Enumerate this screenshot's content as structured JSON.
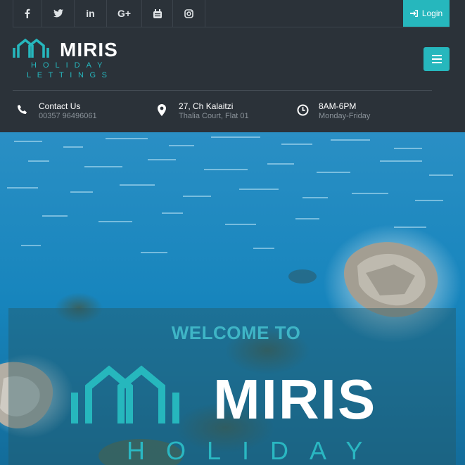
{
  "social": {
    "items": [
      {
        "name": "facebook",
        "icon": "facebook-icon"
      },
      {
        "name": "twitter",
        "icon": "twitter-icon"
      },
      {
        "name": "linkedin",
        "icon": "linkedin-icon",
        "glyph": "in"
      },
      {
        "name": "google-plus",
        "icon": "google-plus-icon",
        "glyph": "G+"
      },
      {
        "name": "youtube",
        "icon": "youtube-icon"
      },
      {
        "name": "instagram",
        "icon": "instagram-icon"
      }
    ]
  },
  "login": {
    "label": "Login",
    "icon": "sign-in-icon"
  },
  "logo": {
    "name": "MIRIS",
    "line1": "HOLIDAY",
    "line2": "LETTINGS"
  },
  "menu": {
    "icon": "hamburger-menu-icon"
  },
  "info": {
    "contact": {
      "title": "Contact Us",
      "detail": "00357 96496061",
      "icon": "phone-icon"
    },
    "address": {
      "title": "27, Ch Kalaitzi",
      "detail": "Thalia Court, Flat 01",
      "icon": "map-pin-icon"
    },
    "hours": {
      "title": "8AM-6PM",
      "detail": "Monday-Friday",
      "icon": "clock-icon"
    }
  },
  "hero": {
    "welcome": "WELCOME TO",
    "brand": "MIRIS",
    "brand_sub": "HOLIDAY"
  },
  "colors": {
    "accent": "#26b7bd",
    "header_bg": "#2b3239",
    "sea": "#1c86b8"
  }
}
